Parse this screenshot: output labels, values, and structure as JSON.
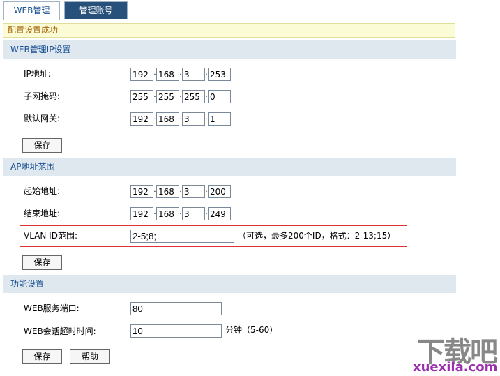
{
  "tabs": [
    {
      "label": "WEB管理"
    },
    {
      "label": "管理账号"
    }
  ],
  "notice": "配置设置成功",
  "sections": {
    "web_ip": {
      "title": "WEB管理IP设置",
      "ip_label": "IP地址:",
      "ip": [
        "192",
        "168",
        "3",
        "253"
      ],
      "mask_label": "子网掩码:",
      "mask": [
        "255",
        "255",
        "255",
        "0"
      ],
      "gateway_label": "默认网关:",
      "gateway": [
        "192",
        "168",
        "3",
        "1"
      ],
      "save": "保存"
    },
    "ap_range": {
      "title": "AP地址范围",
      "start_label": "起始地址:",
      "start": [
        "192",
        "168",
        "3",
        "200"
      ],
      "end_label": "结束地址:",
      "end": [
        "192",
        "168",
        "3",
        "249"
      ],
      "vlan_label": "VLAN ID范围:",
      "vlan_value": "2-5;8;",
      "vlan_hint": "（可选，最多200个ID，格式：2-13;15）",
      "save": "保存"
    },
    "features": {
      "title": "功能设置",
      "port_label": "WEB服务端口:",
      "port_value": "80",
      "timeout_label": "WEB会话超时时间:",
      "timeout_value": "10",
      "timeout_hint": "分钟（5-60）",
      "save": "保存",
      "help": "帮助"
    }
  },
  "watermark": {
    "logo": "下载吧",
    "site": "xuexila.com"
  }
}
